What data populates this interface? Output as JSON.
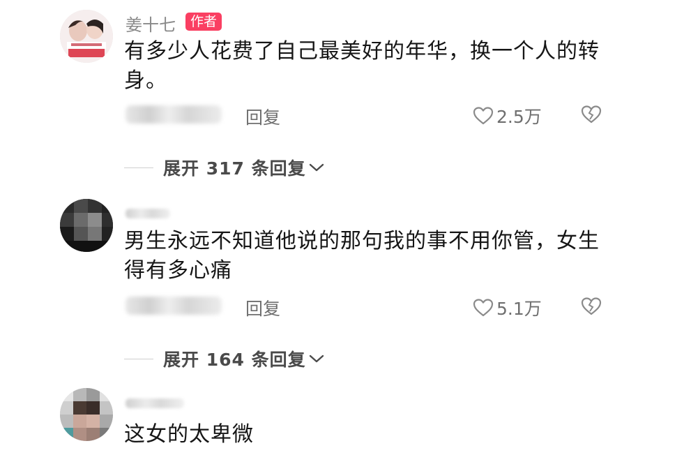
{
  "comments": [
    {
      "username": "姜十七",
      "badge": "作者",
      "text": "有多少人花费了自己最美好的年华，换一个人的转身。",
      "reply_label": "回复",
      "likes": "2.5万",
      "expand_label": "展开 317 条回复"
    },
    {
      "username": "",
      "text": "男生永远不知道他说的那句我的事不用你管，女生得有多心痛",
      "reply_label": "回复",
      "likes": "5.1万",
      "expand_label": "展开 164 条回复"
    },
    {
      "username": "",
      "text": "这女的太卑微"
    }
  ],
  "colors": {
    "badge": "#fa3f62",
    "text": "#161616",
    "muted": "#6f6f6f"
  },
  "icons": {
    "like": "heart-outline-icon",
    "dislike": "broken-heart-icon",
    "expand": "chevron-down-icon"
  }
}
